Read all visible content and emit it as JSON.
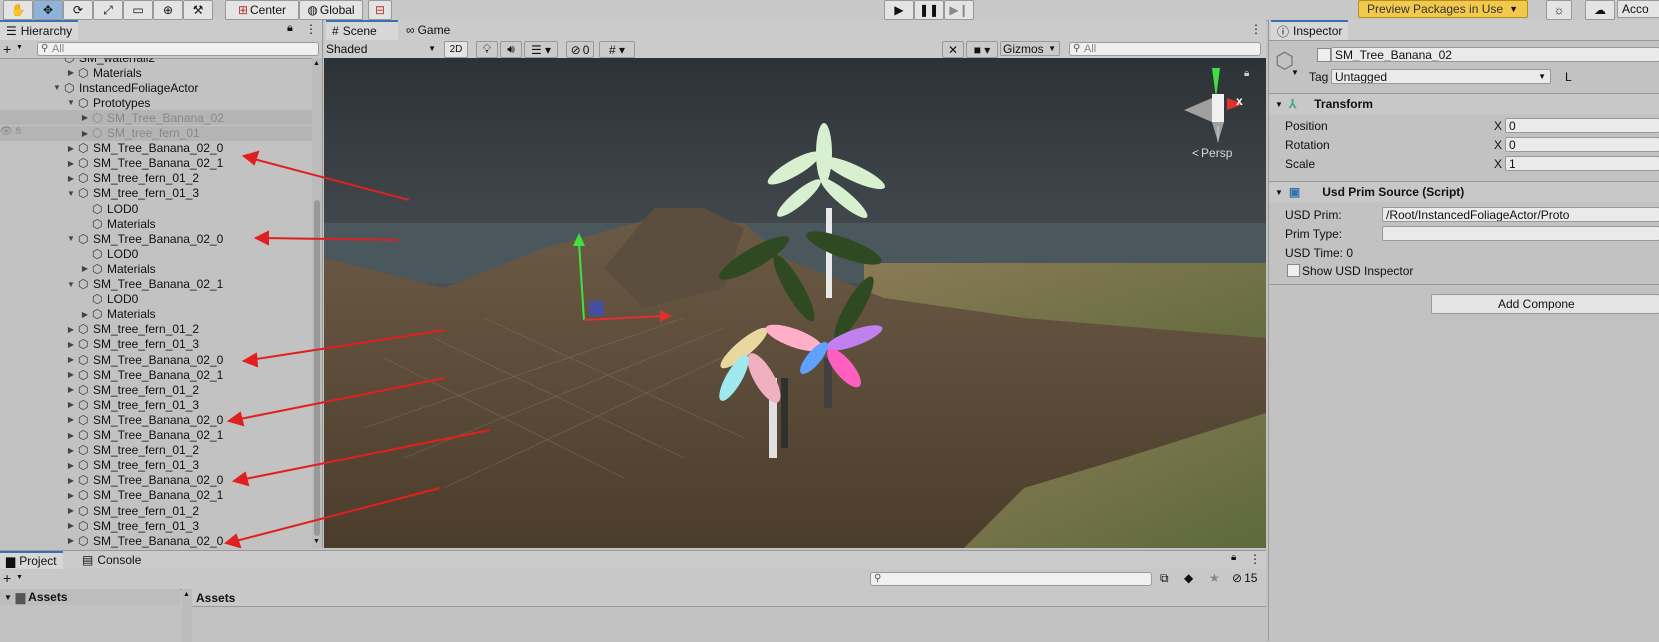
{
  "toolbar": {
    "pivot_label": "Center",
    "space_label": "Global",
    "packages_label": "Preview Packages in Use",
    "account_label": "Acco"
  },
  "hierarchy": {
    "tab_label": "Hierarchy",
    "search_placeholder": "All",
    "rows": [
      {
        "label": "SM_waterfall2",
        "depth": 3,
        "arrow": "",
        "dim": false
      },
      {
        "label": "Materials",
        "depth": 4,
        "arrow": "▶",
        "dim": false
      },
      {
        "label": "InstancedFoliageActor",
        "depth": 3,
        "arrow": "▼",
        "dim": false
      },
      {
        "label": "Prototypes",
        "depth": 4,
        "arrow": "▼",
        "dim": false
      },
      {
        "label": "SM_Tree_Banana_02",
        "depth": 5,
        "arrow": "▶",
        "dim": true
      },
      {
        "label": "SM_tree_fern_01",
        "depth": 5,
        "arrow": "▶",
        "dim": true
      },
      {
        "label": "SM_Tree_Banana_02_0",
        "depth": 4,
        "arrow": "▶",
        "dim": false
      },
      {
        "label": "SM_Tree_Banana_02_1",
        "depth": 4,
        "arrow": "▶",
        "dim": false
      },
      {
        "label": "SM_tree_fern_01_2",
        "depth": 4,
        "arrow": "▶",
        "dim": false
      },
      {
        "label": "SM_tree_fern_01_3",
        "depth": 4,
        "arrow": "▼",
        "dim": false
      },
      {
        "label": "LOD0",
        "depth": 5,
        "arrow": "",
        "dim": false
      },
      {
        "label": "Materials",
        "depth": 5,
        "arrow": "",
        "dim": false
      },
      {
        "label": "SM_Tree_Banana_02_0",
        "depth": 4,
        "arrow": "▼",
        "dim": false
      },
      {
        "label": "LOD0",
        "depth": 5,
        "arrow": "",
        "dim": false
      },
      {
        "label": "Materials",
        "depth": 5,
        "arrow": "▶",
        "dim": false
      },
      {
        "label": "SM_Tree_Banana_02_1",
        "depth": 4,
        "arrow": "▼",
        "dim": false
      },
      {
        "label": "LOD0",
        "depth": 5,
        "arrow": "",
        "dim": false
      },
      {
        "label": "Materials",
        "depth": 5,
        "arrow": "▶",
        "dim": false
      },
      {
        "label": "SM_tree_fern_01_2",
        "depth": 4,
        "arrow": "▶",
        "dim": false
      },
      {
        "label": "SM_tree_fern_01_3",
        "depth": 4,
        "arrow": "▶",
        "dim": false
      },
      {
        "label": "SM_Tree_Banana_02_0",
        "depth": 4,
        "arrow": "▶",
        "dim": false
      },
      {
        "label": "SM_Tree_Banana_02_1",
        "depth": 4,
        "arrow": "▶",
        "dim": false
      },
      {
        "label": "SM_tree_fern_01_2",
        "depth": 4,
        "arrow": "▶",
        "dim": false
      },
      {
        "label": "SM_tree_fern_01_3",
        "depth": 4,
        "arrow": "▶",
        "dim": false
      },
      {
        "label": "SM_Tree_Banana_02_0",
        "depth": 4,
        "arrow": "▶",
        "dim": false
      },
      {
        "label": "SM_Tree_Banana_02_1",
        "depth": 4,
        "arrow": "▶",
        "dim": false
      },
      {
        "label": "SM_tree_fern_01_2",
        "depth": 4,
        "arrow": "▶",
        "dim": false
      },
      {
        "label": "SM_tree_fern_01_3",
        "depth": 4,
        "arrow": "▶",
        "dim": false
      },
      {
        "label": "SM_Tree_Banana_02_0",
        "depth": 4,
        "arrow": "▶",
        "dim": false
      },
      {
        "label": "SM_Tree_Banana_02_1",
        "depth": 4,
        "arrow": "▶",
        "dim": false
      },
      {
        "label": "SM_tree_fern_01_2",
        "depth": 4,
        "arrow": "▶",
        "dim": false
      },
      {
        "label": "SM_tree_fern_01_3",
        "depth": 4,
        "arrow": "▶",
        "dim": false
      },
      {
        "label": "SM_Tree_Banana_02_0",
        "depth": 4,
        "arrow": "▶",
        "dim": false
      }
    ]
  },
  "scene": {
    "tab_scene": "Scene",
    "tab_game": "Game",
    "shading_mode": "Shaded",
    "mode_2d": "2D",
    "hidden_count": "0",
    "gizmos_label": "Gizmos",
    "search_placeholder": "All",
    "persp_label": "Persp",
    "axis_x": "x"
  },
  "inspector": {
    "tab_label": "Inspector",
    "object_name": "SM_Tree_Banana_02",
    "tag_label": "Tag",
    "tag_value": "Untagged",
    "layer_label": "L",
    "transform": {
      "title": "Transform",
      "position_label": "Position",
      "rotation_label": "Rotation",
      "scale_label": "Scale",
      "x_label": "X",
      "position_x": "0",
      "rotation_x": "0",
      "scale_x": "1"
    },
    "usd": {
      "title": "Usd Prim Source (Script)",
      "prim_label": "USD Prim:",
      "prim_value": "/Root/InstancedFoliageActor/Proto",
      "prim_type_label": "Prim Type:",
      "prim_type_value": "",
      "time_text": "USD Time: 0",
      "show_inspector_label": "Show USD Inspector"
    },
    "add_component_label": "Add Compone"
  },
  "project": {
    "tab_project": "Project",
    "tab_console": "Console",
    "hidden_count": "15",
    "assets_folder": "Assets",
    "assets_header": "Assets"
  },
  "colors": {
    "accent": "#3a72b0",
    "annotation_arrow": "#e02020",
    "packages_button": "#f2c94c"
  }
}
